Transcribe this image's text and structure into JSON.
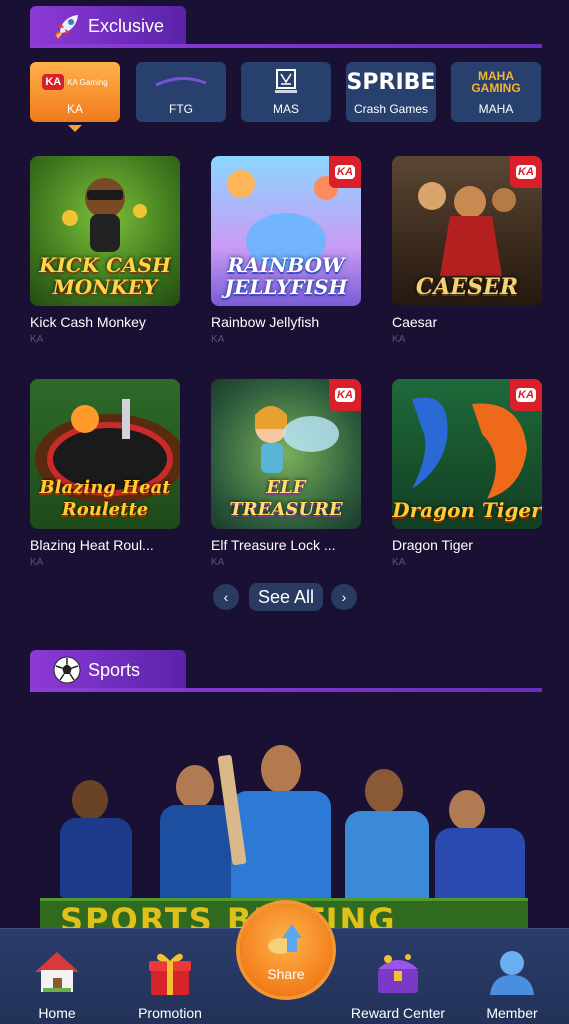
{
  "exclusive_section": {
    "title": "Exclusive",
    "icon": "rocket-icon"
  },
  "providers": [
    {
      "label": "KA",
      "logo_text": "KA Gaming",
      "active": true
    },
    {
      "label": "FTG",
      "logo_text": "",
      "active": false
    },
    {
      "label": "MAS",
      "logo_text": "",
      "active": false
    },
    {
      "label": "Crash Games",
      "logo_text": "SPRIBE",
      "active": false
    },
    {
      "label": "MAHA",
      "logo_text": "MAHA GAMING",
      "active": false
    }
  ],
  "games": [
    {
      "name": "Kick Cash Monkey",
      "provider": "KA",
      "thumb_text": "KICK CASH MONKEY"
    },
    {
      "name": "Rainbow Jellyfish",
      "provider": "KA",
      "thumb_text": "RAINBOW JELLYFISH"
    },
    {
      "name": "Caesar",
      "provider": "KA",
      "thumb_text": "CAESER"
    },
    {
      "name": "Blazing Heat Roul...",
      "provider": "KA",
      "thumb_text": "Blazing Heat Roulette"
    },
    {
      "name": "Elf Treasure Lock ...",
      "provider": "KA",
      "thumb_text": "ELF TREASURE"
    },
    {
      "name": "Dragon Tiger",
      "provider": "KA",
      "thumb_text": "Dragon Tiger"
    }
  ],
  "pager": {
    "see_all": "See All",
    "prev": "‹",
    "next": "›"
  },
  "sports_section": {
    "title": "Sports",
    "icon": "soccer-ball-icon"
  },
  "sports_banner": {
    "board_text": "SPORTS BETTING"
  },
  "bottom_nav": {
    "home": "Home",
    "promotion": "Promotion",
    "share": "Share",
    "reward_center": "Reward Center",
    "member": "Member"
  },
  "colors": {
    "accent": "#8c3ad6",
    "active_provider": "#f28a2a",
    "background": "#1a1033",
    "nav": "#2b3c6b"
  }
}
